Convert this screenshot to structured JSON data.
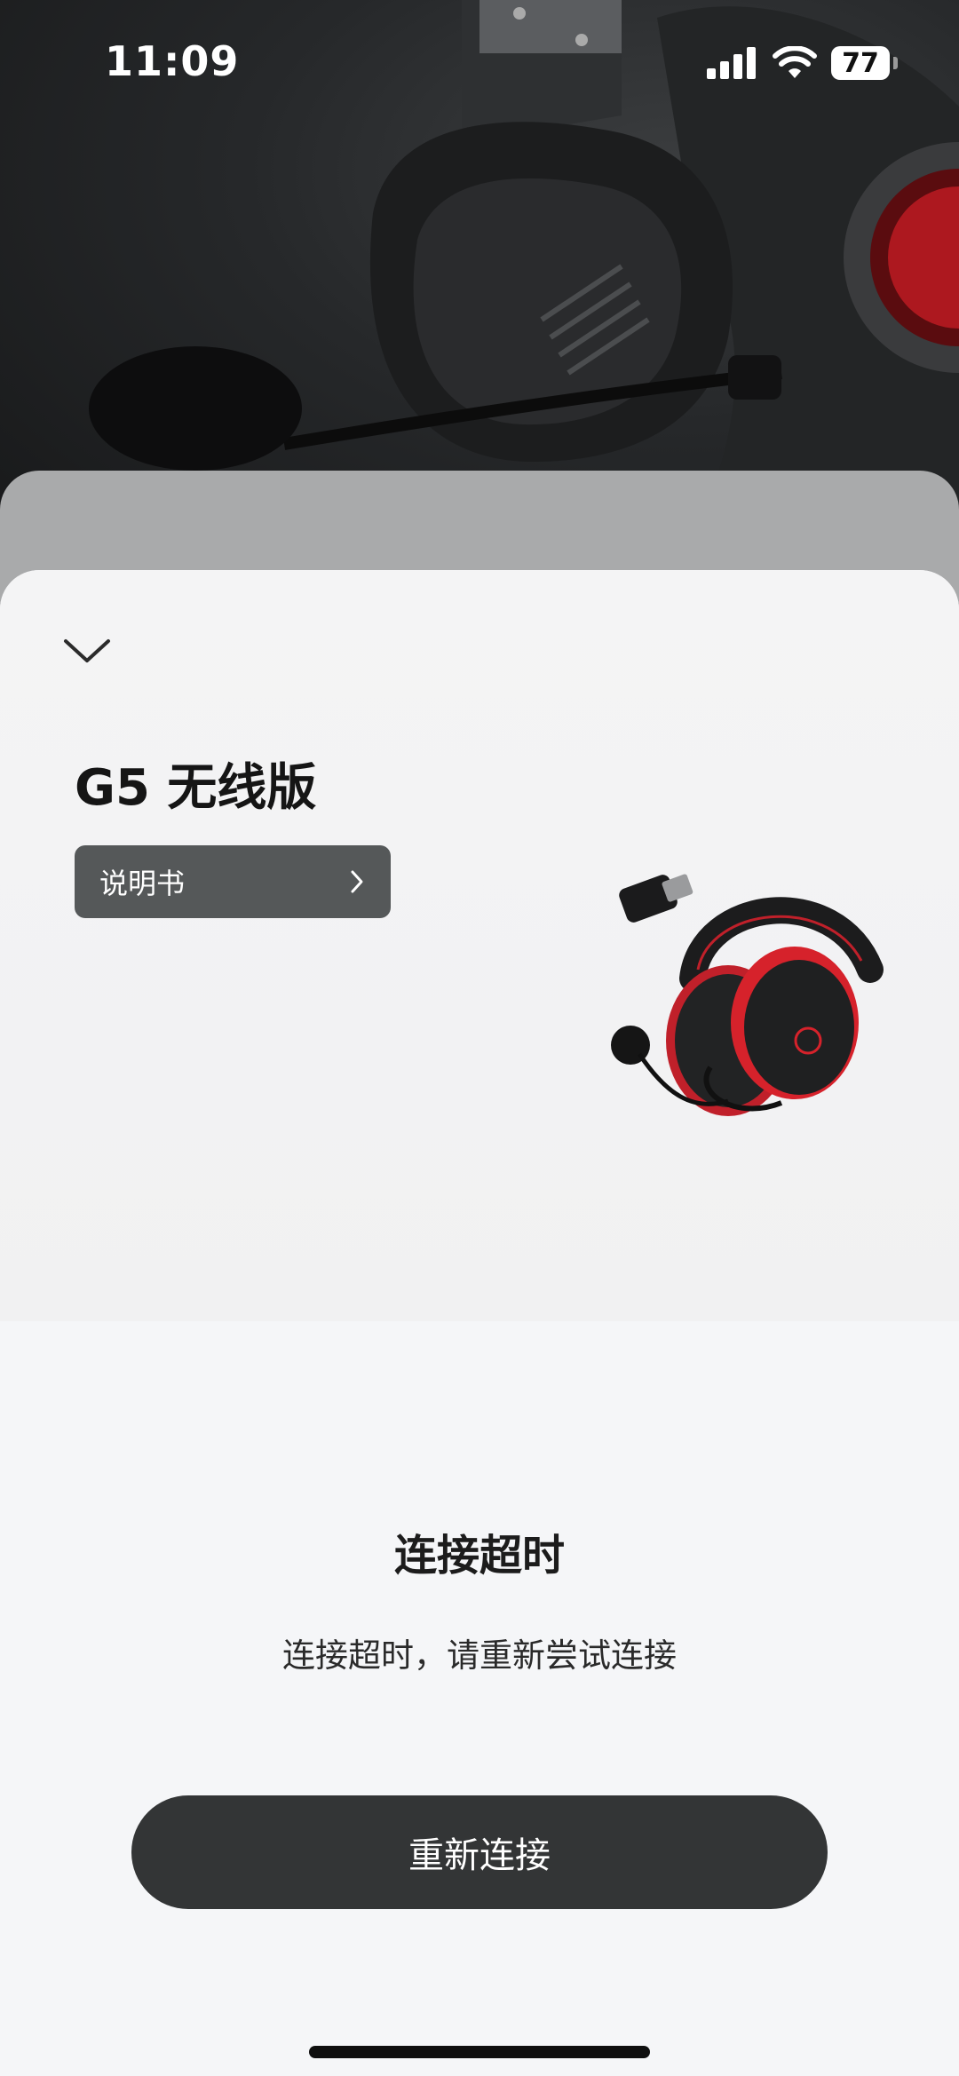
{
  "status_bar": {
    "time": "11:09",
    "battery_level": "77"
  },
  "device": {
    "name": "G5 无线版",
    "manual_label": "说明书"
  },
  "connection": {
    "status_title": "连接超时",
    "status_message": "连接超时，请重新尝试连接",
    "reconnect_label": "重新连接"
  },
  "colors": {
    "accent_red": "#d6222b",
    "button_dark": "#333536"
  }
}
